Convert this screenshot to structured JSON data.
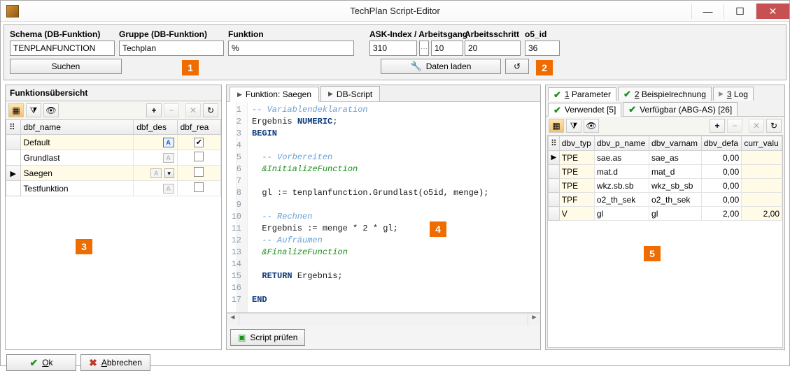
{
  "title": "TechPlan Script-Editor",
  "top": {
    "schema_label": "Schema (DB-Funktion)",
    "schema_value": "TENPLANFUNCTION",
    "gruppe_label": "Gruppe (DB-Funktion)",
    "gruppe_value": "Techplan",
    "funktion_label": "Funktion",
    "funktion_value": "%",
    "ask_label": "ASK-Index / Arbeitsgang",
    "ask_value": "310",
    "ag_value": "10",
    "arbeitsschritt_label": "Arbeitsschritt",
    "arbeitsschritt_value": "20",
    "o5id_label": "o5_id",
    "o5id_value": "36",
    "suchen_label": "Suchen",
    "datenladen_label": "Daten laden"
  },
  "leaf": {
    "chevron": "▾",
    "dots": "···"
  },
  "left": {
    "header": "Funktionsübersicht",
    "cols": {
      "c1": "dbf_name",
      "c2": "dbf_des",
      "c3": "dbf_rea"
    },
    "rows": [
      {
        "name": "Default",
        "desc_on": true,
        "rea": true,
        "sel": false
      },
      {
        "name": "Grundlast",
        "desc_on": false,
        "rea": false,
        "sel": false
      },
      {
        "name": "Saegen",
        "desc_on": false,
        "rea": false,
        "sel": true
      },
      {
        "name": "Testfunktion",
        "desc_on": false,
        "rea": false,
        "sel": false
      }
    ],
    "ok_label": "Ok",
    "cancel_label": "Abbrechen"
  },
  "mid": {
    "tab_funktion": "Funktion: Saegen",
    "tab_dbscript": "DB-Script",
    "code": [
      {
        "t": "-- Variablendeklaration",
        "cls": "c-comment"
      },
      {
        "t": "Ergebnis NUMERIC;",
        "cls": ""
      },
      {
        "t": "BEGIN",
        "cls": "c-kw"
      },
      {
        "t": "",
        "cls": ""
      },
      {
        "t": "  -- Vorbereiten",
        "cls": "c-comment"
      },
      {
        "t": "  &InitializeFunction",
        "cls": "c-macro"
      },
      {
        "t": "",
        "cls": ""
      },
      {
        "t": "  gl := tenplanfunction.Grundlast(o5id, menge);",
        "cls": ""
      },
      {
        "t": "",
        "cls": ""
      },
      {
        "t": "  -- Rechnen",
        "cls": "c-comment"
      },
      {
        "t": "  Ergebnis := menge * 2 * gl;",
        "cls": ""
      },
      {
        "t": "  -- Aufräumen",
        "cls": "c-comment"
      },
      {
        "t": "  &FinalizeFunction",
        "cls": "c-macro"
      },
      {
        "t": "",
        "cls": ""
      },
      {
        "t": "  RETURN Ergebnis;",
        "cls": ""
      },
      {
        "t": "",
        "cls": ""
      },
      {
        "t": "END",
        "cls": "c-kw"
      }
    ],
    "scriptpruefen_label": "Script prüfen"
  },
  "right": {
    "tab_param": "1 Parameter",
    "tab_beisp": "2 Beispielrechnung",
    "tab_log": "3 Log",
    "tab_verw": "Verwendet [5]",
    "tab_verf": "Verfügbar (ABG-AS) [26]",
    "cols": {
      "c1": "dbv_typ",
      "c2": "dbv_p_name",
      "c3": "dbv_varnam",
      "c4": "dbv_defa",
      "c5": "curr_valu"
    },
    "rows": [
      {
        "typ": "TPE",
        "pname": "sae.as",
        "var": "sae_as",
        "def": "0,00",
        "cur": ""
      },
      {
        "typ": "TPE",
        "pname": "mat.d",
        "var": "mat_d",
        "def": "0,00",
        "cur": ""
      },
      {
        "typ": "TPE",
        "pname": "wkz.sb.sb",
        "var": "wkz_sb_sb",
        "def": "0,00",
        "cur": ""
      },
      {
        "typ": "TPF",
        "pname": "o2_th_sek",
        "var": "o2_th_sek",
        "def": "0,00",
        "cur": ""
      },
      {
        "typ": "V",
        "pname": "gl",
        "var": "gl",
        "def": "2,00",
        "cur": "2,00"
      }
    ]
  },
  "callouts": {
    "n1": "1",
    "n2": "2",
    "n3": "3",
    "n4": "4",
    "n5": "5"
  }
}
